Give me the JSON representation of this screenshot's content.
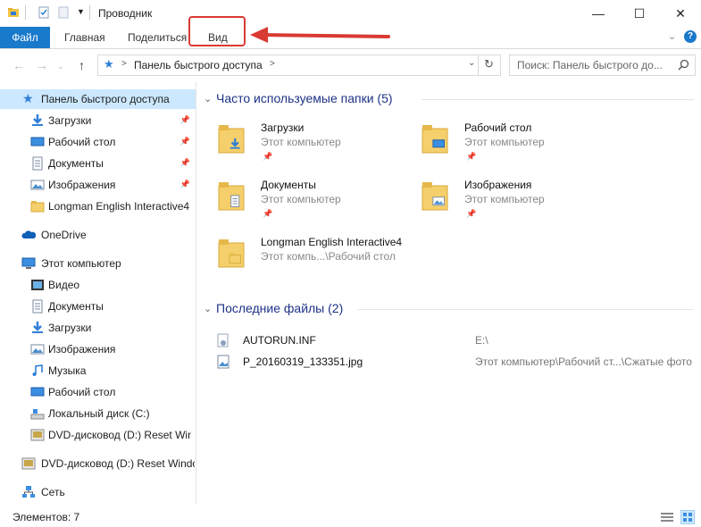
{
  "window": {
    "title": "Проводник",
    "buttons": {
      "minimize": "—",
      "maximize": "☐",
      "close": "✕"
    }
  },
  "ribbon": {
    "tabs": [
      "Файл",
      "Главная",
      "Поделиться",
      "Вид"
    ],
    "highlighted_tab": "Вид",
    "accent": "#1979ca",
    "callout_color": "#d93a32"
  },
  "address_bar": {
    "path": "Панель быстрого доступа",
    "separator": ">",
    "search_placeholder": "Поиск: Панель быстрого до..."
  },
  "nav_pane": {
    "quick_access": {
      "label": "Панель быстрого доступа",
      "selected": true
    },
    "quick_items": [
      {
        "label": "Загрузки",
        "icon": "download-icon",
        "pinned": true
      },
      {
        "label": "Рабочий стол",
        "icon": "desktop-icon",
        "pinned": true
      },
      {
        "label": "Документы",
        "icon": "documents-icon",
        "pinned": true
      },
      {
        "label": "Изображения",
        "icon": "pictures-icon",
        "pinned": true
      },
      {
        "label": "Longman English Interactive4",
        "icon": "folder-icon",
        "pinned": false
      }
    ],
    "onedrive": {
      "label": "OneDrive",
      "icon": "onedrive-icon"
    },
    "this_pc": {
      "label": "Этот компьютер",
      "icon": "computer-icon"
    },
    "pc_items": [
      {
        "label": "Видео",
        "icon": "video-icon"
      },
      {
        "label": "Документы",
        "icon": "documents-icon"
      },
      {
        "label": "Загрузки",
        "icon": "download-icon"
      },
      {
        "label": "Изображения",
        "icon": "pictures-icon"
      },
      {
        "label": "Музыка",
        "icon": "music-icon"
      },
      {
        "label": "Рабочий стол",
        "icon": "desktop-icon"
      },
      {
        "label": "Локальный диск (C:)",
        "icon": "local-disk-icon"
      },
      {
        "label": "DVD-дисковод (D:) Reset Windo",
        "icon": "dvd-drive-icon"
      }
    ],
    "dvd_root": {
      "label": "DVD-дисковод (D:) Reset Windo",
      "icon": "dvd-drive-icon"
    },
    "network": {
      "label": "Сеть",
      "icon": "network-icon"
    }
  },
  "frequent": {
    "title": "Часто используемые папки (5)",
    "folders": [
      {
        "name": "Загрузки",
        "location": "Этот компьютер",
        "pinned": true,
        "overlay": "download-icon"
      },
      {
        "name": "Рабочий стол",
        "location": "Этот компьютер",
        "pinned": true,
        "overlay": "desktop-icon"
      },
      {
        "name": "Документы",
        "location": "Этот компьютер",
        "pinned": true,
        "overlay": "documents-icon"
      },
      {
        "name": "Изображения",
        "location": "Этот компьютер",
        "pinned": true,
        "overlay": "pictures-icon"
      },
      {
        "name": "Longman English Interactive4",
        "location": "Этот компь...\\Рабочий стол",
        "pinned": false,
        "overlay": "folder-icon"
      }
    ]
  },
  "recent": {
    "title": "Последние файлы (2)",
    "files": [
      {
        "name": "AUTORUN.INF",
        "location": "E:\\",
        "icon": "settings-file-icon"
      },
      {
        "name": "P_20160319_133351.jpg",
        "location": "Этот компьютер\\Рабочий ст...\\Сжатые фото",
        "icon": "image-file-icon"
      }
    ]
  },
  "status": {
    "items_count": "Элементов: 7"
  }
}
